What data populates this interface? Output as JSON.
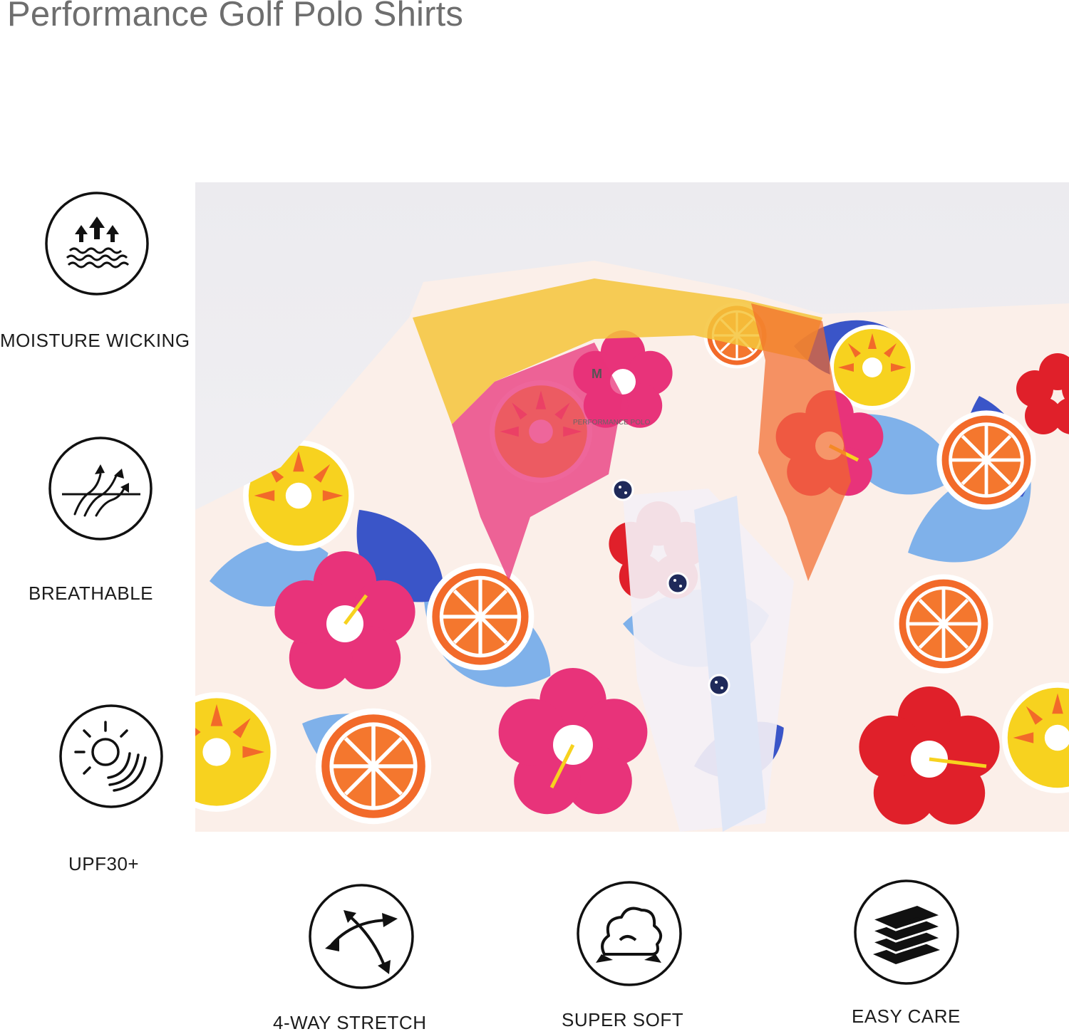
{
  "title": "Performance Golf Polo Shirts",
  "features": [
    {
      "label": "MOISTURE WICKING",
      "icon": "moisture-wicking-icon"
    },
    {
      "label": "BREATHABLE",
      "icon": "breathable-icon"
    },
    {
      "label": "UPF30+",
      "icon": "sun-protection-icon"
    },
    {
      "label": "4-WAY STRETCH",
      "icon": "stretch-arrows-icon"
    },
    {
      "label": "SUPER SOFT",
      "icon": "cotton-soft-icon"
    },
    {
      "label": "EASY CARE",
      "icon": "layers-icon"
    }
  ],
  "colors": {
    "title": "#6e6e6e",
    "icon_stroke": "#111111",
    "print_pink": "#e8337a",
    "print_red": "#e0202a",
    "print_orange": "#f26a2a",
    "print_yellow": "#f7d21f",
    "print_blue": "#3a55c8",
    "print_light_blue": "#7fb1ea"
  },
  "product_photo": {
    "description_icon": "tropical-print-polo-collar-photo",
    "tag_text": "M",
    "tag_line": "PERFORMANCE POLO"
  }
}
